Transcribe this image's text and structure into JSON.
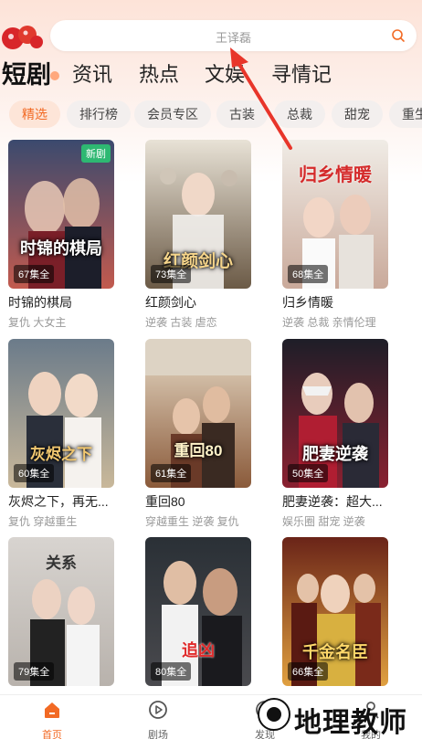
{
  "search": {
    "placeholder": "王译磊"
  },
  "tabs": [
    "短剧",
    "资讯",
    "热点",
    "文娱",
    "寻情记"
  ],
  "chips": [
    "精选",
    "排行榜",
    "会员专区",
    "古装",
    "总裁",
    "甜宠",
    "重生"
  ],
  "dramas": [
    {
      "title": "时锦的棋局",
      "tags": "复仇 大女主",
      "episodes": "67集全",
      "poster_title": "时锦的棋局",
      "badge": "新剧",
      "colors": [
        "#3b4a6e",
        "#c25a4e"
      ]
    },
    {
      "title": "红颜剑心",
      "tags": "逆袭 古装 虐恋",
      "episodes": "73集全",
      "poster_title": "红颜剑心",
      "colors": [
        "#e8e2d6",
        "#6b5a46"
      ]
    },
    {
      "title": "归乡情暖",
      "tags": "逆袭 总裁 亲情伦理",
      "episodes": "68集全",
      "poster_title": "归乡情暖",
      "colors": [
        "#f0ece6",
        "#c9a99a"
      ]
    },
    {
      "title": "灰烬之下，再无...",
      "tags": "复仇 穿越重生",
      "episodes": "60集全",
      "poster_title": "灰烬之下",
      "colors": [
        "#6b7b8a",
        "#c9b89a"
      ]
    },
    {
      "title": "重回80",
      "tags": "穿越重生 逆袭 复仇",
      "episodes": "61集全",
      "poster_title": "重回80",
      "colors": [
        "#5a3a2a",
        "#c98a5a"
      ]
    },
    {
      "title": "肥妻逆袭：超大...",
      "tags": "娱乐圈 甜宠 逆袭",
      "episodes": "50集全",
      "poster_title": "肥妻逆袭",
      "colors": [
        "#1e1e28",
        "#8a2030"
      ]
    },
    {
      "title": "",
      "tags": "",
      "episodes": "79集全",
      "poster_title": "关系",
      "colors": [
        "#d8d4d0",
        "#3a3a3a"
      ]
    },
    {
      "title": "",
      "tags": "",
      "episodes": "80集全",
      "poster_title": "追凶",
      "colors": [
        "#2a3036",
        "#a0302a"
      ]
    },
    {
      "title": "",
      "tags": "",
      "episodes": "66集全",
      "poster_title": "千金名臣",
      "colors": [
        "#6a2418",
        "#e0a040"
      ]
    }
  ],
  "bottom_nav": [
    {
      "label": "首页",
      "icon": "home-icon"
    },
    {
      "label": "剧场",
      "icon": "play-circle-icon"
    },
    {
      "label": "发现",
      "icon": "discover-icon"
    },
    {
      "label": "我的",
      "icon": "profile-icon"
    }
  ],
  "watermark": {
    "text": "地理教师"
  },
  "accent": "#f26a24"
}
